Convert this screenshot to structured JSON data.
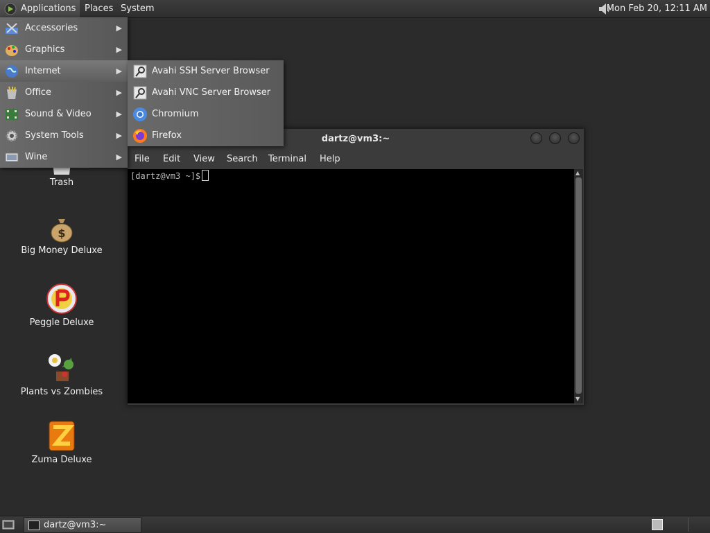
{
  "top_panel": {
    "applications": "Applications",
    "places": "Places",
    "system": "System",
    "clock": "Mon Feb 20, 12:11 AM"
  },
  "applications_menu": {
    "items": [
      {
        "label": "Accessories",
        "icon": "accessories-icon"
      },
      {
        "label": "Graphics",
        "icon": "graphics-icon"
      },
      {
        "label": "Internet",
        "icon": "internet-icon"
      },
      {
        "label": "Office",
        "icon": "office-icon"
      },
      {
        "label": "Sound & Video",
        "icon": "sound-video-icon"
      },
      {
        "label": "System Tools",
        "icon": "system-tools-icon"
      },
      {
        "label": "Wine",
        "icon": "wine-icon"
      }
    ],
    "active": "Internet"
  },
  "internet_submenu": {
    "items": [
      {
        "label": "Avahi SSH Server Browser",
        "icon": "network-browser-icon"
      },
      {
        "label": "Avahi VNC Server Browser",
        "icon": "network-browser-icon"
      },
      {
        "label": "Chromium",
        "icon": "chromium-icon"
      },
      {
        "label": "Firefox",
        "icon": "firefox-icon"
      }
    ]
  },
  "desktop_icons": [
    {
      "label": "Trash",
      "icon": "trash-icon"
    },
    {
      "label": "Big Money Deluxe",
      "icon": "money-bag-icon"
    },
    {
      "label": "Peggle Deluxe",
      "icon": "peggle-icon"
    },
    {
      "label": "Plants vs Zombies",
      "icon": "plants-icon"
    },
    {
      "label": "Zuma Deluxe",
      "icon": "zuma-icon"
    }
  ],
  "terminal": {
    "title": "dartz@vm3:~",
    "menu": [
      "File",
      "Edit",
      "View",
      "Search",
      "Terminal",
      "Help"
    ],
    "prompt": "[dartz@vm3 ~]$"
  },
  "bottom_panel": {
    "task_label": "dartz@vm3:~"
  }
}
